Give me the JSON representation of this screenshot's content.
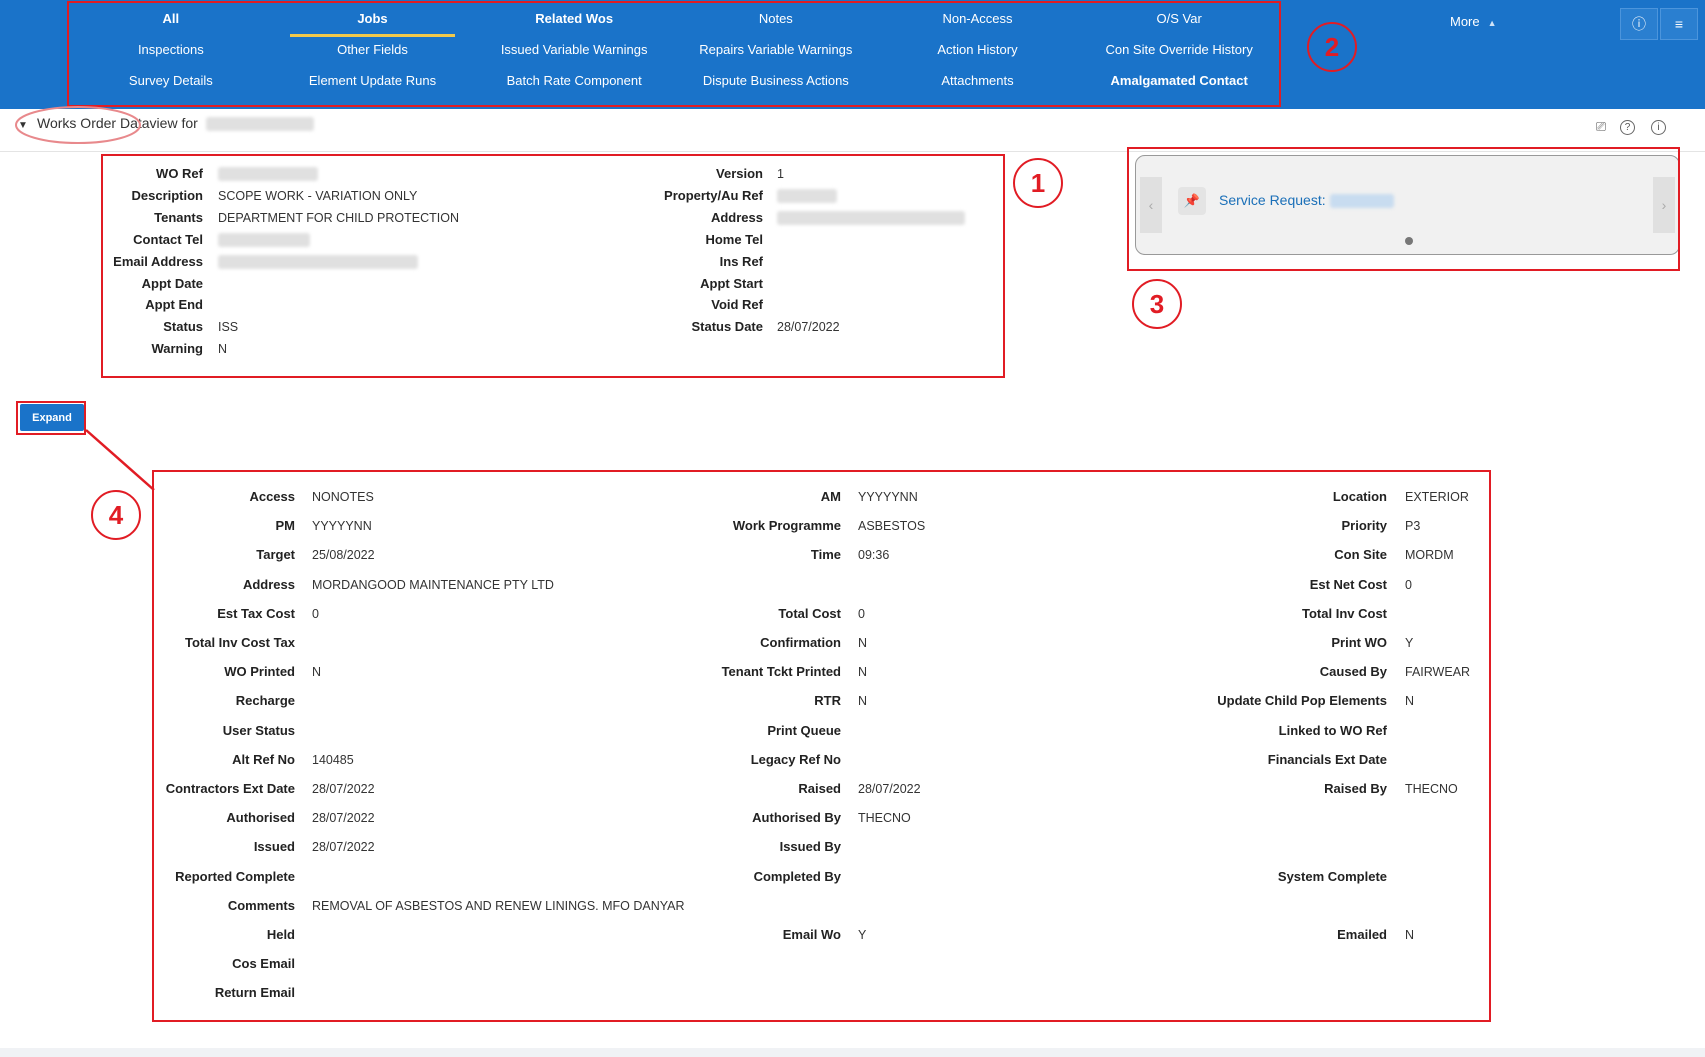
{
  "nav": {
    "items": [
      {
        "label": "All",
        "bold": true
      },
      {
        "label": "Jobs",
        "bold": true,
        "active": true
      },
      {
        "label": "Related Wos",
        "bold": true
      },
      {
        "label": "Notes"
      },
      {
        "label": "Non-Access"
      },
      {
        "label": "O/S Var"
      },
      {
        "label": "Inspections"
      },
      {
        "label": "Other Fields"
      },
      {
        "label": "Issued Variable Warnings"
      },
      {
        "label": "Repairs Variable Warnings"
      },
      {
        "label": "Action History"
      },
      {
        "label": "Con Site Override History"
      },
      {
        "label": "Survey Details"
      },
      {
        "label": "Element Update Runs"
      },
      {
        "label": "Batch Rate Component"
      },
      {
        "label": "Dispute Business Actions"
      },
      {
        "label": "Attachments"
      },
      {
        "label": "Amalgamated Contact",
        "bold": true
      }
    ],
    "more_label": "More",
    "more_caret": "▲",
    "btn1_icon": "ⓘ",
    "btn2_icon": "≡"
  },
  "title": {
    "collapse_icon": "▼",
    "text": "Works Order Dataview for"
  },
  "tool_icons": {
    "camera": "⎚",
    "help": "?",
    "info": "i"
  },
  "annotations": {
    "n1": "1",
    "n2": "2",
    "n3": "3",
    "n4": "4"
  },
  "summary": {
    "left": [
      {
        "label": "WO Ref",
        "value": ""
      },
      {
        "label": "Description",
        "value": "SCOPE WORK - VARIATION ONLY"
      },
      {
        "label": "Tenants",
        "value": "DEPARTMENT FOR CHILD PROTECTION"
      },
      {
        "label": "Contact Tel",
        "value": ""
      },
      {
        "label": "Email Address",
        "value": ""
      },
      {
        "label": "Appt Date",
        "value": ""
      },
      {
        "label": "Appt End",
        "value": ""
      },
      {
        "label": "Status",
        "value": "ISS"
      },
      {
        "label": "Warning",
        "value": "N"
      }
    ],
    "right": [
      {
        "label": "Version",
        "value": "1"
      },
      {
        "label": "Property/Au Ref",
        "value": ""
      },
      {
        "label": "Address",
        "value": ""
      },
      {
        "label": "Home Tel",
        "value": ""
      },
      {
        "label": "Ins Ref",
        "value": ""
      },
      {
        "label": "Appt Start",
        "value": ""
      },
      {
        "label": "Void Ref",
        "value": ""
      },
      {
        "label": "Status Date",
        "value": "28/07/2022"
      }
    ]
  },
  "service_card": {
    "pin_icon": "📌",
    "label": "Service Request:",
    "prev_icon": "‹",
    "next_icon": "›"
  },
  "expand_label": "Expand",
  "details": {
    "rows": [
      [
        [
          "Access",
          "NONOTES"
        ],
        [
          "AM",
          "YYYYYNN"
        ],
        [
          "Location",
          "EXTERIOR"
        ]
      ],
      [
        [
          "PM",
          "YYYYYNN"
        ],
        [
          "Work Programme",
          "ASBESTOS"
        ],
        [
          "Priority",
          "P3"
        ]
      ],
      [
        [
          "Target",
          "25/08/2022"
        ],
        [
          "Time",
          "09:36"
        ],
        [
          "Con Site",
          "MORDM"
        ]
      ],
      [
        [
          "Address",
          "MORDANGOOD MAINTENANCE PTY LTD"
        ],
        null,
        [
          "Est Net Cost",
          "0"
        ]
      ],
      [
        [
          "Est Tax Cost",
          "0"
        ],
        [
          "Total Cost",
          "0"
        ],
        [
          "Total Inv Cost",
          ""
        ]
      ],
      [
        [
          "Total Inv Cost Tax",
          ""
        ],
        [
          "Confirmation",
          "N"
        ],
        [
          "Print WO",
          "Y"
        ]
      ],
      [
        [
          "WO Printed",
          "N"
        ],
        [
          "Tenant Tckt Printed",
          "N"
        ],
        [
          "Caused By",
          "FAIRWEAR"
        ]
      ],
      [
        [
          "Recharge",
          ""
        ],
        [
          "RTR",
          "N"
        ],
        [
          "Update Child Pop Elements",
          "N"
        ]
      ],
      [
        [
          "User Status",
          ""
        ],
        [
          "Print Queue",
          ""
        ],
        [
          "Linked to WO Ref",
          ""
        ]
      ],
      [
        [
          "Alt Ref No",
          "140485"
        ],
        [
          "Legacy Ref No",
          ""
        ],
        [
          "Financials Ext Date",
          ""
        ]
      ],
      [
        [
          "Contractors Ext Date",
          "28/07/2022"
        ],
        [
          "Raised",
          "28/07/2022"
        ],
        [
          "Raised By",
          "THECNO"
        ]
      ],
      [
        [
          "Authorised",
          "28/07/2022"
        ],
        [
          "Authorised By",
          "THECNO"
        ],
        null
      ],
      [
        [
          "Issued",
          "28/07/2022"
        ],
        [
          "Issued By",
          ""
        ],
        null
      ],
      [
        [
          "Reported Complete",
          ""
        ],
        [
          "Completed By",
          ""
        ],
        [
          "System Complete",
          ""
        ]
      ],
      [
        [
          "Comments",
          "REMOVAL OF ASBESTOS AND RENEW LININGS. MFO DANYAR"
        ],
        null,
        null
      ],
      [
        [
          "Held",
          ""
        ],
        [
          "Email Wo",
          "Y"
        ],
        [
          "Emailed",
          "N"
        ]
      ],
      [
        [
          "Cos Email",
          ""
        ],
        null,
        null
      ],
      [
        [
          "Return Email",
          ""
        ],
        null,
        null
      ]
    ]
  }
}
